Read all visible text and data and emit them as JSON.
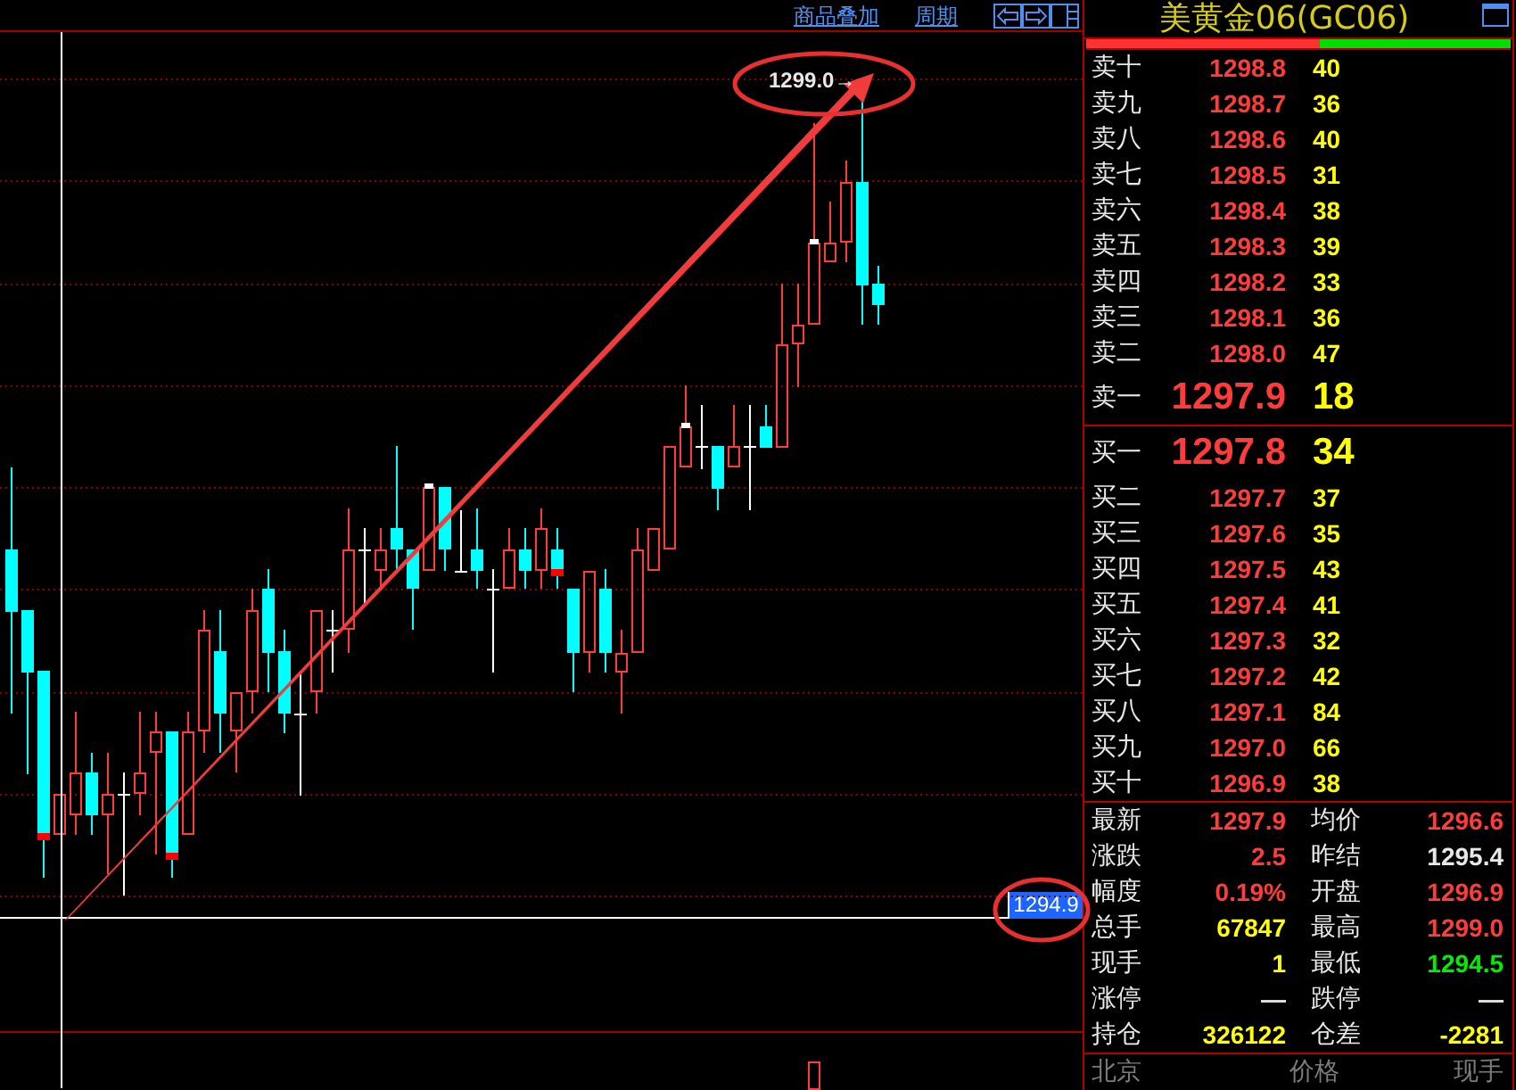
{
  "toolbar": {
    "links": [
      "商品叠加",
      "周期"
    ]
  },
  "chart": {
    "high_label": "1299.0→",
    "crosshair_label": "1294.9"
  },
  "quote": {
    "title": "美黄金06(GC06)",
    "ratio_bar": {
      "level": 0.55
    },
    "asks": [
      {
        "kind": "depth",
        "label": "卖十",
        "price": "1298.8",
        "volume": "40"
      },
      {
        "kind": "depth",
        "label": "卖九",
        "price": "1298.7",
        "volume": "36"
      },
      {
        "kind": "depth",
        "label": "卖八",
        "price": "1298.6",
        "volume": "40"
      },
      {
        "kind": "depth",
        "label": "卖七",
        "price": "1298.5",
        "volume": "31"
      },
      {
        "kind": "depth",
        "label": "卖六",
        "price": "1298.4",
        "volume": "38"
      },
      {
        "kind": "depth",
        "label": "卖五",
        "price": "1298.3",
        "volume": "39"
      },
      {
        "kind": "depth",
        "label": "卖四",
        "price": "1298.2",
        "volume": "33"
      },
      {
        "kind": "depth",
        "label": "卖三",
        "price": "1298.1",
        "volume": "36"
      },
      {
        "kind": "depth",
        "label": "卖二",
        "price": "1298.0",
        "volume": "47"
      },
      {
        "kind": "best",
        "label": "卖一",
        "price": "1297.9",
        "volume": "18"
      }
    ],
    "bids": [
      {
        "kind": "best",
        "label": "买一",
        "price": "1297.8",
        "volume": "34"
      },
      {
        "kind": "depth",
        "label": "买二",
        "price": "1297.7",
        "volume": "37"
      },
      {
        "kind": "depth",
        "label": "买三",
        "price": "1297.6",
        "volume": "35"
      },
      {
        "kind": "depth",
        "label": "买四",
        "price": "1297.5",
        "volume": "43"
      },
      {
        "kind": "depth",
        "label": "买五",
        "price": "1297.4",
        "volume": "41"
      },
      {
        "kind": "depth",
        "label": "买六",
        "price": "1297.3",
        "volume": "32"
      },
      {
        "kind": "depth",
        "label": "买七",
        "price": "1297.2",
        "volume": "42"
      },
      {
        "kind": "depth",
        "label": "买八",
        "price": "1297.1",
        "volume": "84"
      },
      {
        "kind": "depth",
        "label": "买九",
        "price": "1297.0",
        "volume": "66"
      },
      {
        "kind": "depth",
        "label": "买十",
        "price": "1296.9",
        "volume": "38"
      }
    ],
    "stats": [
      {
        "label": "最新",
        "value": "1297.9",
        "color": "#ff3c3c"
      },
      {
        "label": "均价",
        "value": "1296.6",
        "color": "#ff3c3c"
      },
      {
        "label": "涨跌",
        "value": "2.5",
        "color": "#ff3c3c"
      },
      {
        "label": "昨结",
        "value": "1295.4",
        "color": "#e8e8e8"
      },
      {
        "label": "幅度",
        "value": "0.19%",
        "color": "#ff3c3c"
      },
      {
        "label": "开盘",
        "value": "1296.9",
        "color": "#ff3c3c"
      },
      {
        "label": "总手",
        "value": "67847",
        "color": "#ffff00"
      },
      {
        "label": "最高",
        "value": "1299.0",
        "color": "#ff3c3c"
      },
      {
        "label": "现手",
        "value": "1",
        "color": "#ffff00"
      },
      {
        "label": "最低",
        "value": "1294.5",
        "color": "#00ee00"
      },
      {
        "label": "涨停",
        "value": "—",
        "color": "#e8e8e8"
      },
      {
        "label": "跌停",
        "value": "—",
        "color": "#e8e8e8"
      },
      {
        "label": "持仓",
        "value": "326122",
        "color": "#ffff00"
      },
      {
        "label": "仓差",
        "value": "-2281",
        "color": "#ffff00"
      }
    ],
    "footer": [
      "北京",
      "价格",
      "现手"
    ]
  }
}
